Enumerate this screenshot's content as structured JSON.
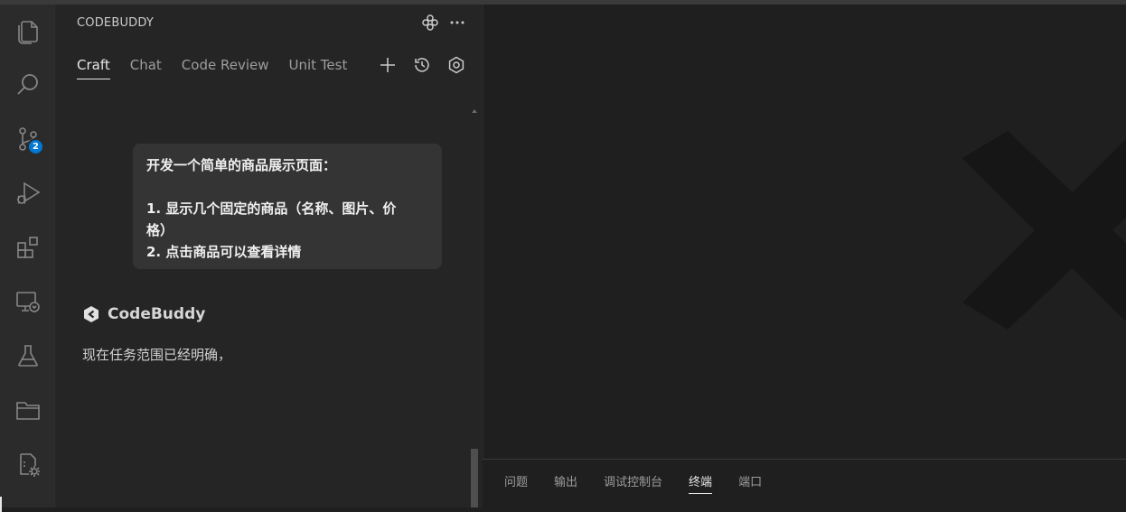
{
  "activity_bar": {
    "items": [
      {
        "icon": "files-icon"
      },
      {
        "icon": "search-icon"
      },
      {
        "icon": "source-control-icon",
        "badge": "2"
      },
      {
        "icon": "run-debug-icon"
      },
      {
        "icon": "extensions-icon"
      },
      {
        "icon": "remote-explorer-icon"
      },
      {
        "icon": "testing-icon"
      },
      {
        "icon": "folder-icon"
      },
      {
        "icon": "codebuddy-file-settings-icon"
      }
    ]
  },
  "side_panel": {
    "title": "CODEBUDDY",
    "tabs": [
      {
        "label": "Craft",
        "active": true
      },
      {
        "label": "Chat",
        "active": false
      },
      {
        "label": "Code Review",
        "active": false
      },
      {
        "label": "Unit Test",
        "active": false
      }
    ],
    "user_message": {
      "line1": "开发一个简单的商品展示页面：",
      "line2": "1. 显示几个固定的商品（名称、图片、价",
      "line3": "格）",
      "line4": "2. 点击商品可以查看详情"
    },
    "assistant": {
      "name": "CodeBuddy",
      "text": "现在任务范围已经明确，"
    }
  },
  "bottom_panel": {
    "tabs": [
      {
        "label": "问题",
        "active": false
      },
      {
        "label": "输出",
        "active": false
      },
      {
        "label": "调试控制台",
        "active": false
      },
      {
        "label": "终端",
        "active": true
      },
      {
        "label": "端口",
        "active": false
      }
    ]
  },
  "colors": {
    "accent": "#0078d4",
    "panel_bg": "#252526",
    "editor_bg": "#1f1f1f",
    "bubble_bg": "#343434"
  }
}
